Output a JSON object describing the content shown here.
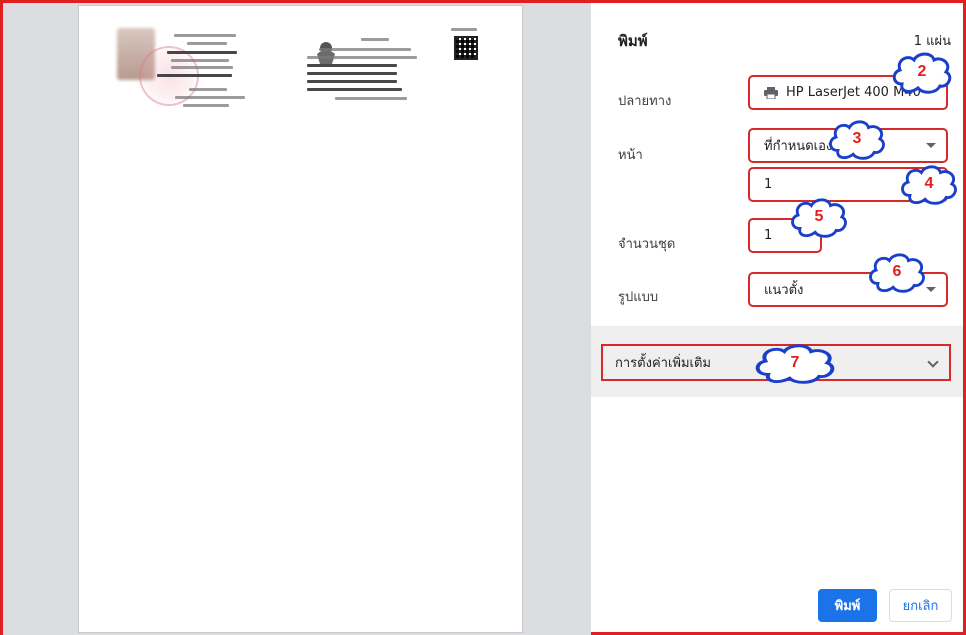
{
  "dialog": {
    "title": "พิมพ์",
    "sheet_count": "1 แผ่น"
  },
  "destination": {
    "label": "ปลายทาง",
    "value": "HP LaserJet 400 M40",
    "icon": "printer-icon"
  },
  "pages": {
    "label": "หน้า",
    "value": "ที่กำหนดเอง",
    "custom_value": "1"
  },
  "copies": {
    "label": "จำนวนชุด",
    "value": "1"
  },
  "layout": {
    "label": "รูปแบบ",
    "value": "แนวตั้ง"
  },
  "more_settings": {
    "label": "การตั้งค่าเพิ่มเติม"
  },
  "buttons": {
    "print": "พิมพ์",
    "cancel": "ยกเลิก"
  },
  "callouts": [
    "2",
    "3",
    "4",
    "5",
    "6",
    "7"
  ],
  "colors": {
    "highlight": "#d42a2a",
    "accent": "#1a73e8",
    "callout_text": "#e02020"
  }
}
